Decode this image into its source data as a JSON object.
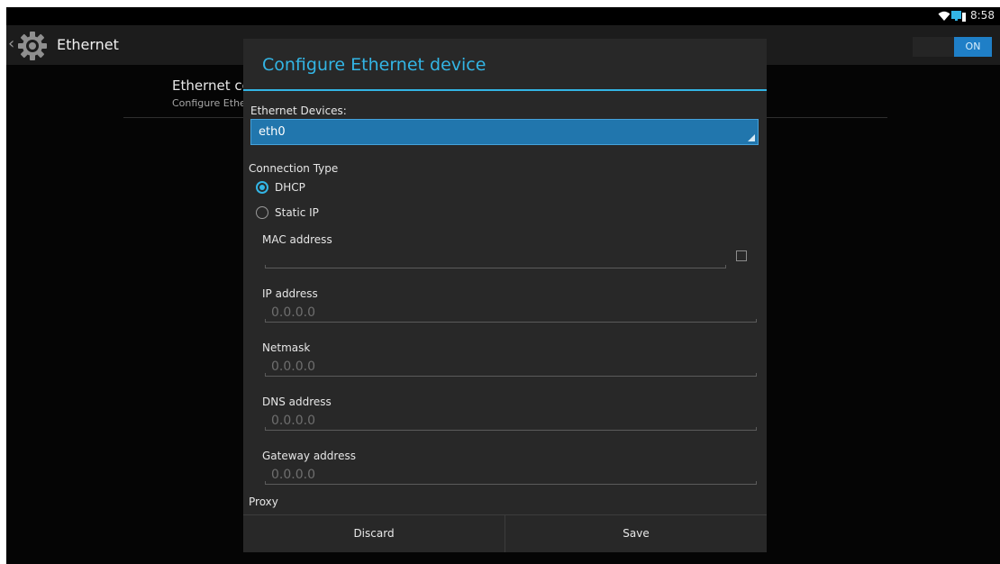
{
  "status_bar": {
    "clock": "8:58",
    "icons": [
      "wifi-icon",
      "ethernet-icon"
    ]
  },
  "action_bar": {
    "title": "Ethernet",
    "icon": "gear-icon",
    "switch_label": "ON"
  },
  "background_pref": {
    "title": "Ethernet co",
    "summary": "Configure Ethe"
  },
  "dialog": {
    "title": "Configure Ethernet device",
    "devices_label": "Ethernet Devices:",
    "device_selected": "eth0",
    "connection_type_label": "Connection Type",
    "options": [
      {
        "label": "DHCP",
        "selected": true
      },
      {
        "label": "Static IP",
        "selected": false
      }
    ],
    "mac_label": "MAC address",
    "mac_value": "",
    "mac_checkbox_checked": false,
    "ip_label": "IP address",
    "ip_hint": "0.0.0.0",
    "netmask_label": "Netmask",
    "netmask_hint": "0.0.0.0",
    "dns_label": "DNS address",
    "dns_hint": "0.0.0.0",
    "gateway_label": "Gateway address",
    "gateway_hint": "0.0.0.0",
    "proxy_label": "Proxy",
    "discard_label": "Discard",
    "save_label": "Save"
  },
  "colors": {
    "accent": "#33b5e5",
    "spinner_bg": "#2176ad",
    "switch_on": "#1f7fc7",
    "dialog_bg": "#282828"
  }
}
